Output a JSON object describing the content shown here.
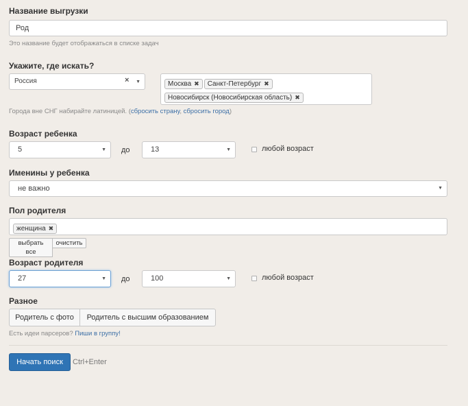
{
  "export_name": {
    "label": "Название выгрузки",
    "value": "Род",
    "hint": "Это название будет отображаться в списке задач"
  },
  "location": {
    "label": "Укажите, где искать?",
    "country": "Россия",
    "clear_glyph": "×",
    "cities": [
      "Москва",
      "Санкт-Петербург",
      "Новосибирск (Новосибирская область)"
    ],
    "hint_prefix": "Города вне СНГ набирайте латиницей. (",
    "reset_country": "сбросить страну",
    "separator": ", ",
    "reset_city": "сбросить город",
    "hint_suffix": ")"
  },
  "child_age": {
    "label": "Возраст ребенка",
    "from": "5",
    "to_label": "до",
    "to": "13",
    "any_label": "любой возраст"
  },
  "child_nameday": {
    "label": "Именины у ребенка",
    "value": "не важно"
  },
  "parent_gender": {
    "label": "Пол родителя",
    "tags": [
      "женщина"
    ],
    "select_all": "выбрать все",
    "clear": "очистить"
  },
  "parent_age": {
    "label": "Возраст родителя",
    "from": "27",
    "to_label": "до",
    "to": "100",
    "any_label": "любой возраст"
  },
  "misc": {
    "label": "Разное",
    "options": [
      "Родитель с фото",
      "Родитель с высшим образованием"
    ],
    "hint_prefix": "Есть идеи парсеров? ",
    "hint_link": "Пиши в группу!"
  },
  "actions": {
    "submit": "Начать поиск",
    "shortcut": "Ctrl+Enter"
  },
  "icons": {
    "dropdown": "chevron-down-icon",
    "remove": "close-icon"
  }
}
